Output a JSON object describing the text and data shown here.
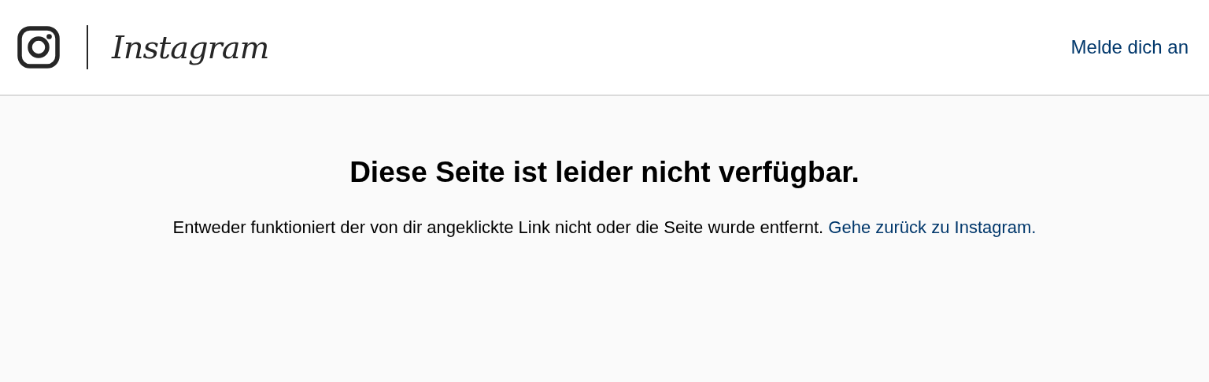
{
  "header": {
    "logo_text": "Instagram",
    "login_link": "Melde dich an"
  },
  "error": {
    "title": "Diese Seite ist leider nicht verfügbar.",
    "message": "Entweder funktioniert der von dir angeklickte Link nicht oder die Seite wurde entfernt.",
    "back_link": "Gehe zurück zu Instagram."
  }
}
